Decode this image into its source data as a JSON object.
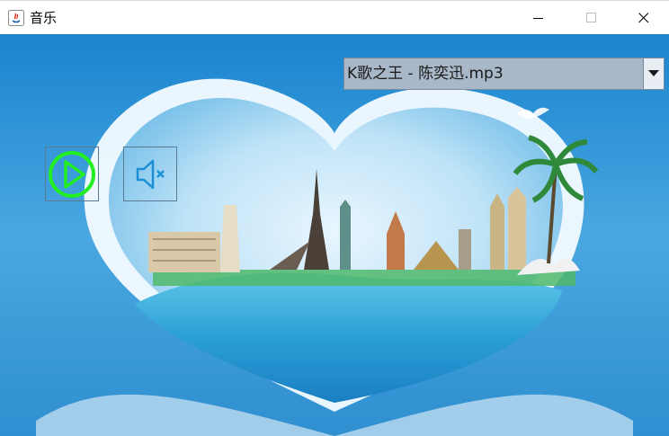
{
  "window": {
    "title": "音乐",
    "minimize_icon": "minimize-icon",
    "maximize_icon": "maximize-icon",
    "close_icon": "close-icon"
  },
  "player": {
    "selected_song": "K歌之王 - 陈奕迅.mp3",
    "play_icon": "play-icon",
    "mute_icon": "mute-speaker-icon",
    "play_color": "#22ee22",
    "mute_color": "#1a8fd6"
  }
}
